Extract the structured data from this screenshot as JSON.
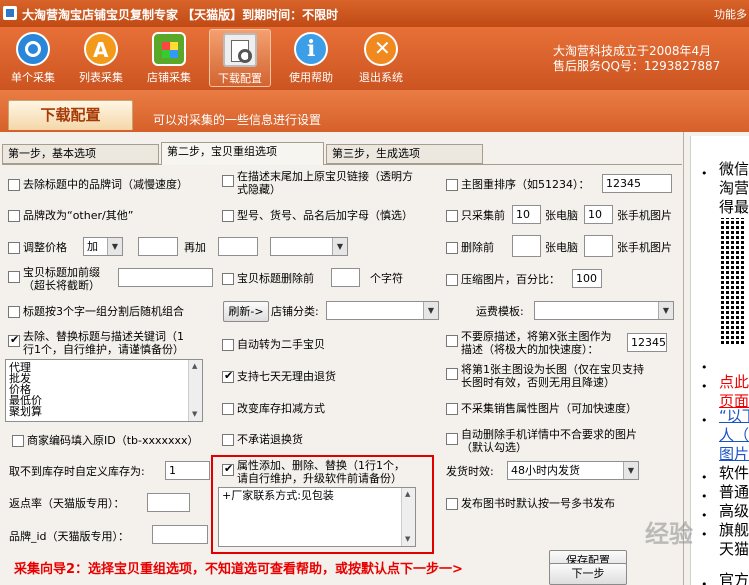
{
  "titlebar": {
    "title": "大淘营淘宝店铺宝贝复制专家  【天猫版】到期时间：不限时",
    "function_label": "功能多"
  },
  "toolbar": {
    "buttons": [
      {
        "label": "单个采集",
        "icon": "single-collect-icon"
      },
      {
        "label": "列表采集",
        "icon": "list-collect-icon"
      },
      {
        "label": "店铺采集",
        "icon": "shop-collect-icon"
      },
      {
        "label": "下载配置",
        "icon": "download-config-icon"
      },
      {
        "label": "使用帮助",
        "icon": "help-icon"
      },
      {
        "label": "退出系统",
        "icon": "exit-icon"
      }
    ],
    "company_line1": "大淘营科技成立于2008年4月",
    "company_line2": "售后服务QQ号：1293827887"
  },
  "band": {
    "tab_label": "下载配置",
    "description": "可以对采集的一些信息进行设置"
  },
  "steps": {
    "step1": "第一步，基本选项",
    "step2": "第二步，宝贝重组选项",
    "step3": "第三步，生成选项"
  },
  "col1": {
    "remove_brand": "去除标题中的品牌词（减慢速度）",
    "brand_change": "品牌改为“other/其他”",
    "adjust_price": "调整价格",
    "adjust_op": "加",
    "adjust_value": "",
    "add_again": "再加",
    "add_again_value": "",
    "title_prefix_l1": "宝贝标题加前缀",
    "title_prefix_l2": "（超长将截断）",
    "title_prefix_value": "",
    "title_shuffle": "标题按3个字一组分割后随机组合",
    "replace_keywords_l1": "去除、替换标题与描述关键词（1",
    "replace_keywords_l2": "行1个，自行维护，请谨慎备份）",
    "keywords": [
      "代理",
      "批发",
      "价格",
      "最低价",
      "聚划算"
    ],
    "merchant_code": "商家编码填入原ID（tb-xxxxxxx）",
    "custom_stock_label": "取不到库存时自定义库存为:",
    "custom_stock_value": "1",
    "rebate_label": "返点率（天猫版专用）：",
    "rebate_value": "",
    "brand_id_label": "品牌_id（天猫版专用）：",
    "brand_id_value": ""
  },
  "col2": {
    "orig_link_l1": "在描述末尾加上原宝贝链接（透明方",
    "orig_link_l2": "式隐藏）",
    "model_suffix": "型号、货号、品名后加字母（慎选）",
    "adjust_select_value": "",
    "title_prefix_remove": "宝贝标题删除前",
    "title_prefix_remove_value": "",
    "chars_label": "个字符",
    "refresh_button": "刷新->",
    "shop_category_label": "店铺分类:",
    "shop_category_value": "",
    "second_hand": "自动转为二手宝贝",
    "seven_day_return": "支持七天无理由退货",
    "reduce_stock": "改变库存扣减方式",
    "no_return": "不承诺退换货",
    "attr_l1": "属性添加、删除、替换（1行1个，",
    "attr_l2": "请自行维护，升级软件前请备份）",
    "attr_text": "+厂家联系方式:见包装"
  },
  "col3": {
    "main_image_sort": "主图重排序（如51234）：",
    "main_image_sort_value": "12345",
    "collect_front_only": "只采集前",
    "collect_front_pc_value": "10",
    "pc_label": "张电脑",
    "collect_front_mobile_value": "10",
    "mobile_label": "张手机图片",
    "delete_front": "删除前",
    "delete_pc_value": "",
    "delete_pc_label": "张电脑",
    "delete_mobile_value": "",
    "delete_mobile_label": "张手机图片",
    "compress_label": "压缩图片，百分比：",
    "compress_value": "100",
    "freight_label": "运费模板:",
    "freight_value": "",
    "no_orig_desc_l1": "不要原描述，将第X张主图作为",
    "no_orig_desc_l2": "描述（将极大的加快速度）：",
    "no_orig_desc_value": "12345",
    "long_image_l1": "将第1张主图设为长图（仅在宝贝支持",
    "long_image_l2": "长图时有效，否则无用且降速）",
    "no_sale_attr": "不采集销售属性图片（可加快速度）",
    "mobile_detail_l1": "自动删除手机详情中不合要求的图片",
    "mobile_detail_l2": "（默认勾选）",
    "ship_label": "发货时效:",
    "ship_value": "48小时内发货",
    "book_one_multi": "发布图书时默认按一号多书发布"
  },
  "footer": {
    "wizard": "采集向导2：选择宝贝重组选项，不知道选可查看帮助，或按默认点下一步一>",
    "save_config": "保存配置",
    "next_step": "下一步"
  },
  "side": {
    "lines": [
      "微信",
      "淘营",
      "得最",
      "",
      "点此",
      "页面",
      "“以下",
      "人（",
      "图片",
      "软件",
      "普通",
      "高级",
      "旗舰",
      "天猫",
      "官方"
    ]
  },
  "watermark": "经验"
}
